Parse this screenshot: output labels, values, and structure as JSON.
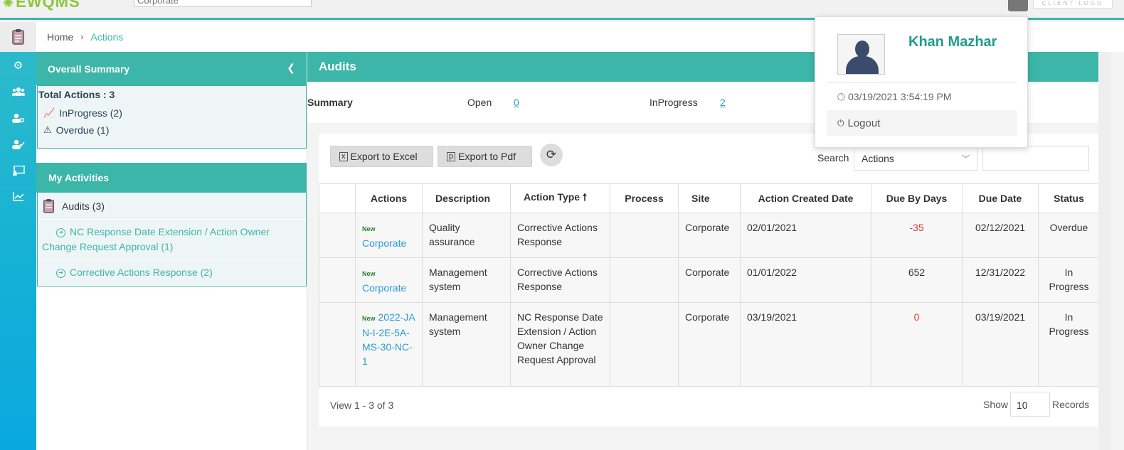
{
  "app": {
    "logo": "EWQMS",
    "site_value": "Corporate",
    "client_logo": "CLIENT LOGO"
  },
  "breadcrumb": {
    "home": "Home",
    "current": "Actions"
  },
  "nav_icons": [
    "gear-icon",
    "users-icon",
    "user-settings-icon",
    "user-check-icon",
    "monitor-user-icon",
    "chart-line-icon"
  ],
  "overall": {
    "title": "Overall Summary",
    "total": "Total Actions : 3",
    "inprogress": "InProgress (2)",
    "overdue": "Overdue (1)"
  },
  "activities": {
    "title": "My Activities",
    "audits": "Audits (3)",
    "items": [
      "NC Response Date Extension / Action Owner Change Request Approval (1)",
      "Corrective Actions Response (2)"
    ]
  },
  "main": {
    "title": "Audits",
    "summary_label": "Summary",
    "open_label": "Open",
    "open_value": "0",
    "inprogress_label": "InProgress",
    "inprogress_value": "2"
  },
  "toolbar": {
    "export_excel": "Export to Excel",
    "export_pdf": "Export to Pdf",
    "search_label": "Search",
    "search_select": "Actions",
    "search_value": ""
  },
  "table": {
    "columns": [
      "",
      "Actions",
      "Description",
      "Action Type",
      "Process",
      "Site",
      "Action Created Date",
      "Due By Days",
      "Due Date",
      "Status"
    ],
    "sort_indicator": "🠕",
    "new_tag": "New",
    "rows": [
      {
        "action": "Corporate",
        "description": "Quality assurance",
        "type": "Corrective Actions Response",
        "process": "",
        "site": "Corporate",
        "created": "02/01/2021",
        "due_days": "-35",
        "due_date": "02/12/2021",
        "status": "Overdue"
      },
      {
        "action": "Corporate",
        "description": "Management system",
        "type": "Corrective Actions Response",
        "process": "",
        "site": "Corporate",
        "created": "01/01/2022",
        "due_days": "652",
        "due_date": "12/31/2022",
        "status": "In Progress"
      },
      {
        "action": "2022-JAN-I-2E-5A-MS-30-NC-1",
        "description": "Management system",
        "type": "NC Response Date Extension / Action Owner Change Request Approval",
        "process": "",
        "site": "Corporate",
        "created": "03/19/2021",
        "due_days": "0",
        "due_date": "03/19/2021",
        "status": "In Progress"
      }
    ]
  },
  "footer": {
    "view": "View 1 - 3 of 3",
    "show": "Show",
    "records_value": "10",
    "records": "Records"
  },
  "profile": {
    "name": "Khan Mazhar",
    "time": "03/19/2021 3:54:19 PM",
    "logout": "Logout"
  }
}
